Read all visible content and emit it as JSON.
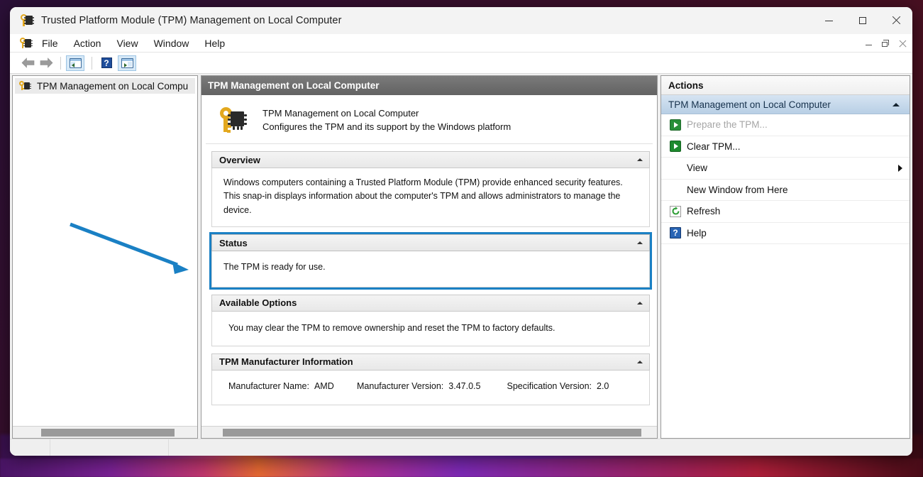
{
  "window": {
    "title": "Trusted Platform Module (TPM) Management on Local Computer",
    "icon": "tpm-key-chip-icon",
    "controls": {
      "minimize": "Minimize",
      "maximize": "Maximize",
      "close": "Close"
    }
  },
  "mdi_controls": {
    "minimize": "Minimize",
    "restore": "Restore",
    "close": "Close"
  },
  "menubar": {
    "items": [
      {
        "label": "File"
      },
      {
        "label": "Action"
      },
      {
        "label": "View"
      },
      {
        "label": "Window"
      },
      {
        "label": "Help"
      }
    ]
  },
  "toolbar": {
    "buttons": [
      {
        "name": "back-arrow-icon",
        "label": "Back"
      },
      {
        "name": "forward-arrow-icon",
        "label": "Forward"
      },
      {
        "name": "show-console-tree-icon",
        "label": "Show/Hide Console Tree"
      },
      {
        "name": "help-icon",
        "label": "Help",
        "glyph": "?"
      },
      {
        "name": "show-action-pane-icon",
        "label": "Show/Hide Action Pane"
      }
    ]
  },
  "tree": {
    "items": [
      {
        "label": "TPM Management on Local Compu",
        "icon": "tpm-key-chip-icon",
        "selected": true
      }
    ]
  },
  "result": {
    "header": "TPM Management on Local Computer",
    "banner": {
      "icon": "tpm-key-chip-icon",
      "title": "TPM Management on Local Computer",
      "subtitle": "Configures the TPM and its support by the Windows platform"
    },
    "sections": [
      {
        "name": "overview",
        "title": "Overview",
        "body": "Windows computers containing a Trusted Platform Module (TPM) provide enhanced security features. This snap-in displays information about the computer's TPM and allows administrators to manage the device.",
        "highlighted": false
      },
      {
        "name": "status",
        "title": "Status",
        "body": "The TPM is ready for use.",
        "highlighted": true
      },
      {
        "name": "available-options",
        "title": "Available Options",
        "body": "You may clear the TPM to remove ownership and reset the TPM to factory defaults.",
        "highlighted": false
      }
    ],
    "manufacturer_section": {
      "name": "tpm-manufacturer-information",
      "title": "TPM Manufacturer Information",
      "fields": [
        {
          "label": "Manufacturer Name:",
          "value": "AMD"
        },
        {
          "label": "Manufacturer Version:",
          "value": "3.47.0.5"
        },
        {
          "label": "Specification Version:",
          "value": "2.0"
        }
      ]
    }
  },
  "actions": {
    "header": "Actions",
    "group_title": "TPM Management on Local Computer",
    "items": [
      {
        "label": "Prepare the TPM...",
        "icon": "green-arrow-icon",
        "disabled": true,
        "submenu": false
      },
      {
        "label": "Clear TPM...",
        "icon": "green-arrow-icon",
        "disabled": false,
        "submenu": false
      },
      {
        "label": "View",
        "icon": "",
        "disabled": false,
        "submenu": true
      },
      {
        "label": "New Window from Here",
        "icon": "",
        "disabled": false,
        "submenu": false
      },
      {
        "label": "Refresh",
        "icon": "refresh-icon",
        "disabled": false,
        "submenu": false
      },
      {
        "label": "Help",
        "icon": "help-icon",
        "disabled": false,
        "submenu": false
      }
    ]
  },
  "statusbar": {
    "seg1": "",
    "seg2": "",
    "seg3": ""
  },
  "annotation": {
    "type": "arrow",
    "color": "#1a80c4",
    "points": "from (98,316) to (265,380)",
    "target": "status-section"
  },
  "colors": {
    "accent_highlight": "#1a80c4",
    "result_header_bg": "#6e6e6e",
    "actions_group_bg": "#c6d9ec",
    "green_icon": "#1d8a2e",
    "help_icon": "#2864b4"
  }
}
